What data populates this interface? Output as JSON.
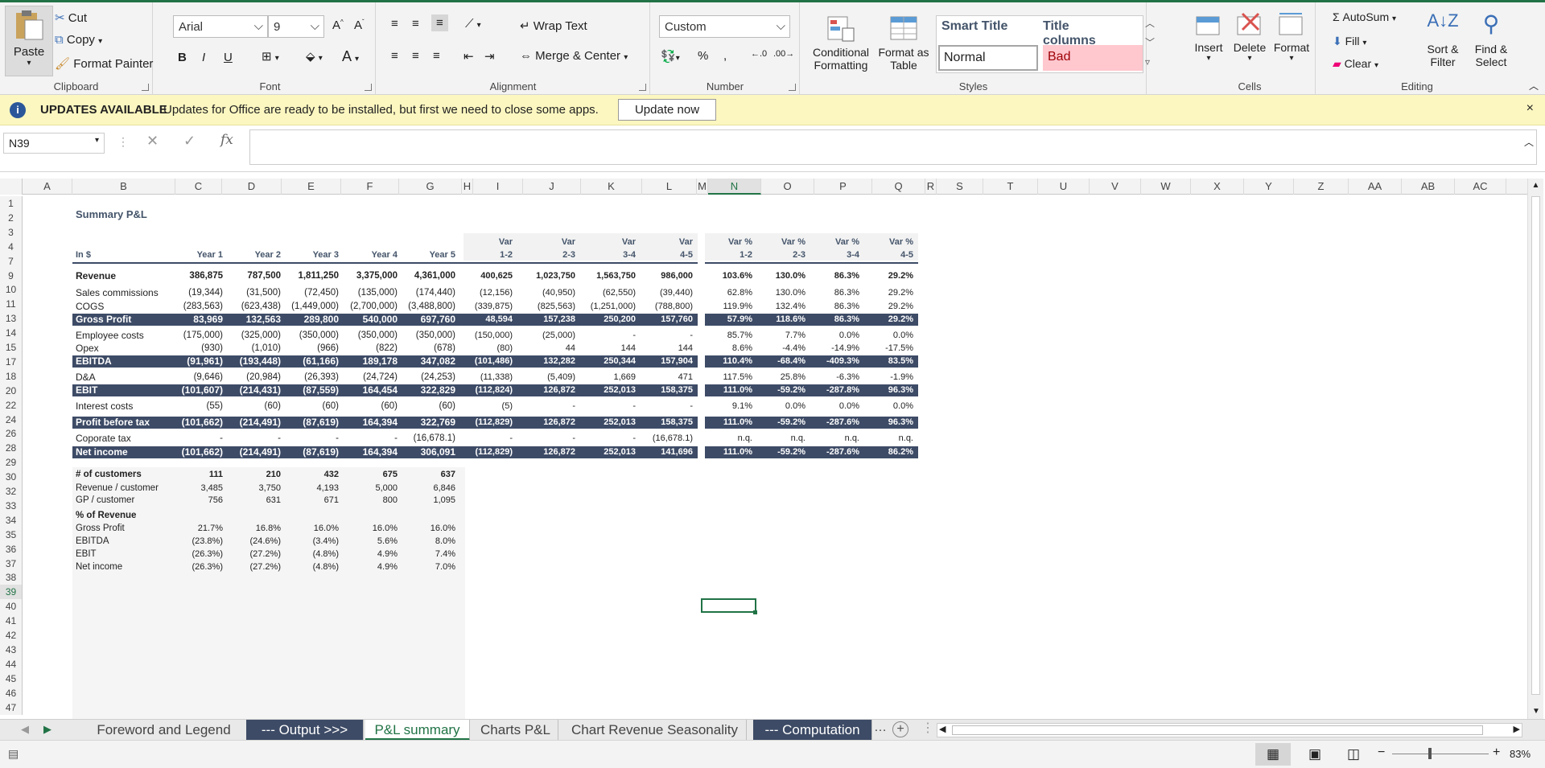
{
  "ribbon": {
    "clipboard": {
      "paste": "Paste",
      "cut": "Cut",
      "copy": "Copy",
      "format_painter": "Format Painter",
      "label": "Clipboard"
    },
    "font": {
      "name": "Arial",
      "size": "9",
      "bold": "B",
      "italic": "I",
      "underline": "U",
      "label": "Font"
    },
    "alignment": {
      "wrap": "Wrap Text",
      "merge": "Merge & Center",
      "label": "Alignment"
    },
    "number": {
      "format": "Custom",
      "label": "Number"
    },
    "styles": {
      "cond_line1": "Conditional",
      "cond_line2": "Formatting",
      "fmt_line1": "Format as",
      "fmt_line2": "Table",
      "smart_title": "Smart Title",
      "title_columns": "Title columns",
      "normal": "Normal",
      "bad": "Bad",
      "label": "Styles"
    },
    "cells": {
      "insert": "Insert",
      "delete": "Delete",
      "format": "Format",
      "label": "Cells"
    },
    "editing": {
      "autosum": "AutoSum",
      "fill": "Fill",
      "clear": "Clear",
      "sort_line1": "Sort &",
      "sort_line2": "Filter",
      "find_line1": "Find &",
      "find_line2": "Select",
      "label": "Editing"
    }
  },
  "banner": {
    "title": "UPDATES AVAILABLE",
    "message": "Updates for Office are ready to be installed, but first we need to close some apps.",
    "button": "Update now"
  },
  "formula_bar": {
    "name_box": "N39",
    "formula": ""
  },
  "columns": [
    "A",
    "B",
    "C",
    "D",
    "E",
    "F",
    "G",
    "H",
    "I",
    "J",
    "K",
    "L",
    "M",
    "N",
    "O",
    "P",
    "Q",
    "R",
    "S",
    "T",
    "U",
    "V",
    "W",
    "X",
    "Y",
    "Z",
    "AA",
    "AB",
    "AC"
  ],
  "rows": [
    "1",
    "2",
    "3",
    "4",
    "7",
    "9",
    "10",
    "11",
    "13",
    "14",
    "15",
    "17",
    "18",
    "20",
    "22",
    "24",
    "26",
    "28",
    "29",
    "30",
    "32",
    "33",
    "34",
    "35",
    "36",
    "37",
    "38",
    "39",
    "40",
    "41",
    "42",
    "43",
    "44",
    "45",
    "46",
    "47"
  ],
  "sheet": {
    "title": "Summary P&L",
    "unit": "In $",
    "year_headers": [
      "Year 1",
      "Year 2",
      "Year 3",
      "Year 4",
      "Year 5"
    ],
    "var_headers": [
      [
        "Var",
        "1-2"
      ],
      [
        "Var",
        "2-3"
      ],
      [
        "Var",
        "3-4"
      ],
      [
        "Var",
        "4-5"
      ]
    ],
    "varpct_headers": [
      [
        "Var %",
        "1-2"
      ],
      [
        "Var %",
        "2-3"
      ],
      [
        "Var %",
        "3-4"
      ],
      [
        "Var %",
        "4-5"
      ]
    ],
    "pl_rows": [
      {
        "label": "Revenue",
        "style": "bold",
        "years": [
          "386,875",
          "787,500",
          "1,811,250",
          "3,375,000",
          "4,361,000"
        ],
        "var": [
          "400,625",
          "1,023,750",
          "1,563,750",
          "986,000"
        ],
        "pct": [
          "103.6%",
          "130.0%",
          "86.3%",
          "29.2%"
        ]
      },
      {
        "label": "Sales commissions",
        "style": "plain",
        "years": [
          "(19,344)",
          "(31,500)",
          "(72,450)",
          "(135,000)",
          "(174,440)"
        ],
        "var": [
          "(12,156)",
          "(40,950)",
          "(62,550)",
          "(39,440)"
        ],
        "pct": [
          "62.8%",
          "130.0%",
          "86.3%",
          "29.2%"
        ]
      },
      {
        "label": "COGS",
        "style": "plain",
        "years": [
          "(283,563)",
          "(623,438)",
          "(1,449,000)",
          "(2,700,000)",
          "(3,488,800)"
        ],
        "var": [
          "(339,875)",
          "(825,563)",
          "(1,251,000)",
          "(788,800)"
        ],
        "pct": [
          "119.9%",
          "132.4%",
          "86.3%",
          "29.2%"
        ]
      },
      {
        "label": "Gross Profit",
        "style": "band",
        "years": [
          "83,969",
          "132,563",
          "289,800",
          "540,000",
          "697,760"
        ],
        "var": [
          "48,594",
          "157,238",
          "250,200",
          "157,760"
        ],
        "pct": [
          "57.9%",
          "118.6%",
          "86.3%",
          "29.2%"
        ]
      },
      {
        "label": "Employee costs",
        "style": "plain",
        "years": [
          "(175,000)",
          "(325,000)",
          "(350,000)",
          "(350,000)",
          "(350,000)"
        ],
        "var": [
          "(150,000)",
          "(25,000)",
          "-",
          "-"
        ],
        "pct": [
          "85.7%",
          "7.7%",
          "0.0%",
          "0.0%"
        ]
      },
      {
        "label": "Opex",
        "style": "plain",
        "years": [
          "(930)",
          "(1,010)",
          "(966)",
          "(822)",
          "(678)"
        ],
        "var": [
          "(80)",
          "44",
          "144",
          "144"
        ],
        "pct": [
          "8.6%",
          "-4.4%",
          "-14.9%",
          "-17.5%"
        ]
      },
      {
        "label": "EBITDA",
        "style": "band",
        "years": [
          "(91,961)",
          "(193,448)",
          "(61,166)",
          "189,178",
          "347,082"
        ],
        "var": [
          "(101,486)",
          "132,282",
          "250,344",
          "157,904"
        ],
        "pct": [
          "110.4%",
          "-68.4%",
          "-409.3%",
          "83.5%"
        ]
      },
      {
        "label": "D&A",
        "style": "plain",
        "years": [
          "(9,646)",
          "(20,984)",
          "(26,393)",
          "(24,724)",
          "(24,253)"
        ],
        "var": [
          "(11,338)",
          "(5,409)",
          "1,669",
          "471"
        ],
        "pct": [
          "117.5%",
          "25.8%",
          "-6.3%",
          "-1.9%"
        ]
      },
      {
        "label": "EBIT",
        "style": "band",
        "years": [
          "(101,607)",
          "(214,431)",
          "(87,559)",
          "164,454",
          "322,829"
        ],
        "var": [
          "(112,824)",
          "126,872",
          "252,013",
          "158,375"
        ],
        "pct": [
          "111.0%",
          "-59.2%",
          "-287.8%",
          "96.3%"
        ]
      },
      {
        "label": "Interest costs",
        "style": "plain",
        "years": [
          "(55)",
          "(60)",
          "(60)",
          "(60)",
          "(60)"
        ],
        "var": [
          "(5)",
          "-",
          "-",
          "-"
        ],
        "pct": [
          "9.1%",
          "0.0%",
          "0.0%",
          "0.0%"
        ]
      },
      {
        "label": "Profit before tax",
        "style": "band",
        "years": [
          "(101,662)",
          "(214,491)",
          "(87,619)",
          "164,394",
          "322,769"
        ],
        "var": [
          "(112,829)",
          "126,872",
          "252,013",
          "158,375"
        ],
        "pct": [
          "111.0%",
          "-59.2%",
          "-287.6%",
          "96.3%"
        ]
      },
      {
        "label": "Coporate tax",
        "style": "plain",
        "years": [
          "-",
          "-",
          "-",
          "-",
          "(16,678.1)"
        ],
        "var": [
          "-",
          "-",
          "-",
          "(16,678.1)"
        ],
        "pct": [
          "n.q.",
          "n.q.",
          "n.q.",
          "n.q."
        ]
      },
      {
        "label": "Net income",
        "style": "band",
        "years": [
          "(101,662)",
          "(214,491)",
          "(87,619)",
          "164,394",
          "306,091"
        ],
        "var": [
          "(112,829)",
          "126,872",
          "252,013",
          "141,696"
        ],
        "pct": [
          "111.0%",
          "-59.2%",
          "-287.6%",
          "86.2%"
        ]
      }
    ],
    "kpi_rows": [
      {
        "label": "# of customers",
        "style": "bold",
        "years": [
          "111",
          "210",
          "432",
          "675",
          "637"
        ]
      },
      {
        "label": "Revenue / customer",
        "style": "plain",
        "years": [
          "3,485",
          "3,750",
          "4,193",
          "5,000",
          "6,846"
        ]
      },
      {
        "label": "GP / customer",
        "style": "plain",
        "years": [
          "756",
          "631",
          "671",
          "800",
          "1,095"
        ]
      },
      {
        "label": "% of Revenue",
        "style": "bold",
        "years": [
          "",
          "",
          "",
          "",
          ""
        ]
      },
      {
        "label": "Gross Profit",
        "style": "plain",
        "years": [
          "21.7%",
          "16.8%",
          "16.0%",
          "16.0%",
          "16.0%"
        ]
      },
      {
        "label": "EBITDA",
        "style": "plain",
        "years": [
          "(23.8%)",
          "(24.6%)",
          "(3.4%)",
          "5.6%",
          "8.0%"
        ]
      },
      {
        "label": "EBIT",
        "style": "plain",
        "years": [
          "(26.3%)",
          "(27.2%)",
          "(4.8%)",
          "4.9%",
          "7.4%"
        ]
      },
      {
        "label": "Net income",
        "style": "plain",
        "years": [
          "(26.3%)",
          "(27.2%)",
          "(4.8%)",
          "4.9%",
          "7.0%"
        ]
      }
    ]
  },
  "tabs": [
    "Foreword and Legend",
    "--- Output >>>",
    "P&L summary",
    "Charts P&L",
    "Chart Revenue Seasonality",
    "--- Computation"
  ],
  "active_tab": "P&L summary",
  "status": {
    "zoom": "83%",
    "minus": "−",
    "plus": "+"
  },
  "colors": {
    "excel_green": "#217346",
    "band": "#3d4b66",
    "banner": "#fcf7c0",
    "bad_fill": "#ffc7ce",
    "bad_text": "#9c0006"
  }
}
